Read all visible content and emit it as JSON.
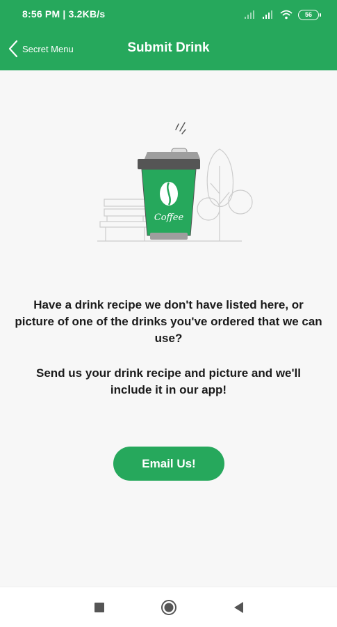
{
  "status_bar": {
    "time_speed": "8:56 PM | 3.2KB/s",
    "battery": "56"
  },
  "app_bar": {
    "back_label": "Secret Menu",
    "title": "Submit Drink"
  },
  "illustration": {
    "cup_label": "Coffee"
  },
  "content": {
    "message_1": "Have a drink recipe we don't have listed here, or picture of one of the drinks you've ordered that we can use?",
    "message_2": "Send us your drink recipe and picture and we'll include it in our app!"
  },
  "actions": {
    "email_label": "Email Us!"
  },
  "colors": {
    "brand_green": "#26a85c",
    "background": "#f7f7f7",
    "text": "#1a1a1a"
  },
  "nav_bar": {
    "icons": [
      "recents-icon",
      "home-icon",
      "back-icon"
    ]
  }
}
